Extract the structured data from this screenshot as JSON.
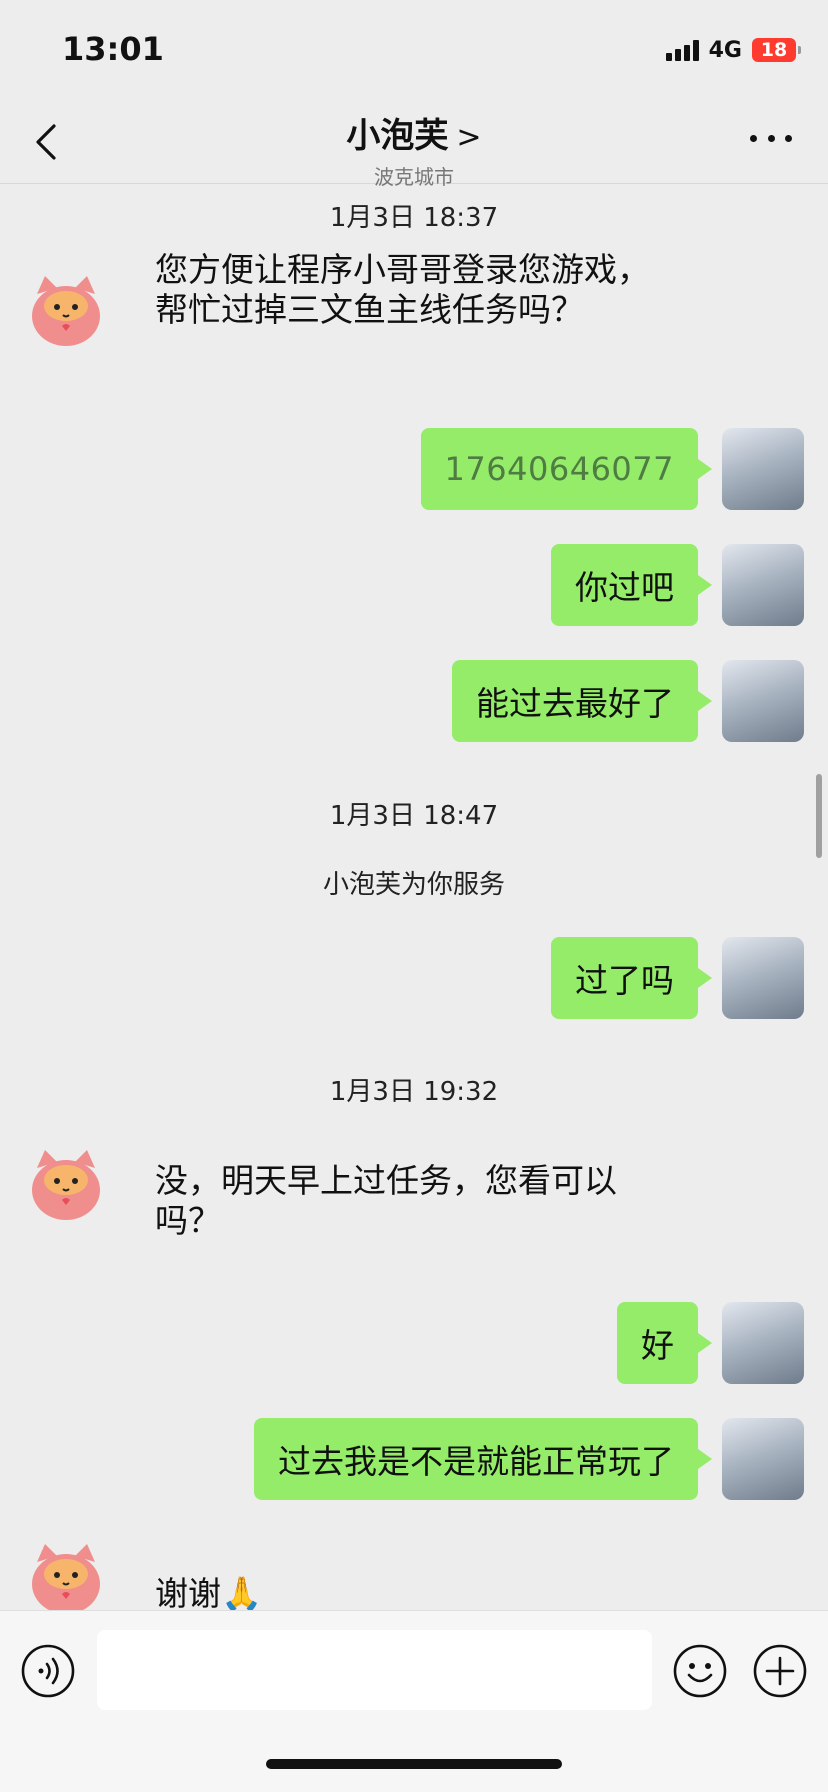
{
  "status": {
    "time": "13:01",
    "network": "4G",
    "battery": "18"
  },
  "header": {
    "title": "小泡芙",
    "title_arrow": ">",
    "subtitle": "波克城市"
  },
  "messages": [
    {
      "type": "timestamp",
      "text": "1月3日 18:37"
    },
    {
      "type": "incoming",
      "text": "您方便让程序小哥哥登录您游戏，帮忙过掉三文鱼主线任务吗？"
    },
    {
      "type": "outgoing",
      "text": "17640646077"
    },
    {
      "type": "outgoing",
      "text": "你过吧"
    },
    {
      "type": "outgoing",
      "text": "能过去最好了"
    },
    {
      "type": "timestamp",
      "text": "1月3日 18:47"
    },
    {
      "type": "notice",
      "text": "小泡芙为你服务"
    },
    {
      "type": "outgoing",
      "text": "过了吗"
    },
    {
      "type": "timestamp",
      "text": "1月3日 19:32"
    },
    {
      "type": "incoming",
      "text": "没，明天早上过任务，您看可以吗？"
    },
    {
      "type": "outgoing",
      "text": "好"
    },
    {
      "type": "outgoing",
      "text": "过去我是不是就能正常玩了"
    },
    {
      "type": "incoming",
      "text": "谢谢🙏"
    }
  ],
  "colors": {
    "outgoing_bubble": "#95ec69",
    "chat_background": "#ededed",
    "cat_avatar": "#f08e8e"
  },
  "icons": {
    "back": "chevron-left-icon",
    "more": "more-dots-icon",
    "voice": "voice-icon",
    "emoji": "emoji-icon",
    "plus": "plus-icon"
  }
}
